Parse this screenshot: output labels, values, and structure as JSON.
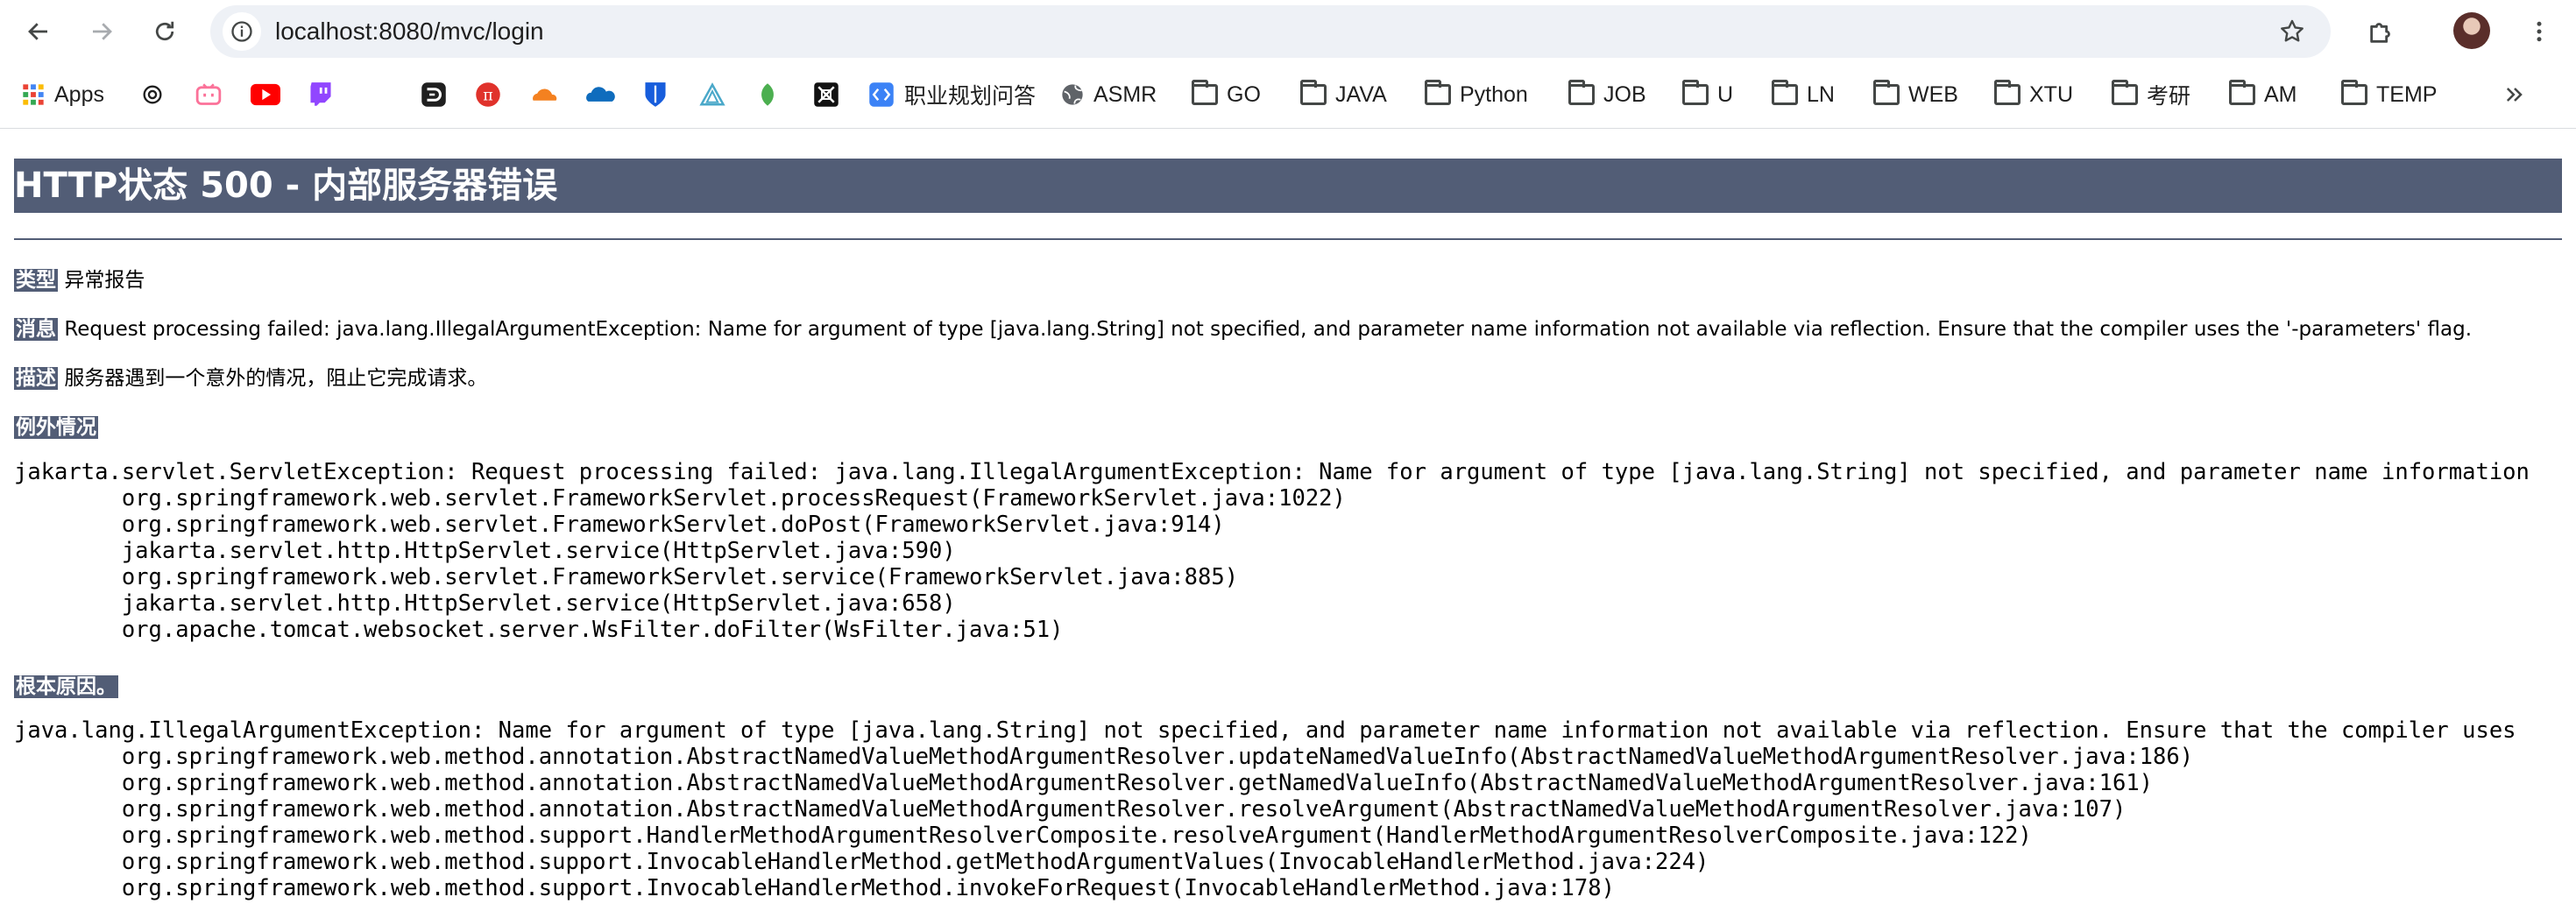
{
  "browser": {
    "url": "localhost:8080/mvc/login",
    "bookmarks": [
      {
        "label": "Apps",
        "icon": "apps-grid-icon"
      },
      {
        "label": "",
        "icon": "openai-icon"
      },
      {
        "label": "",
        "icon": "bilibili-icon"
      },
      {
        "label": "",
        "icon": "youtube-icon"
      },
      {
        "label": "",
        "icon": "twitch-icon"
      },
      {
        "label": "",
        "icon": "dash-icon"
      },
      {
        "label": "",
        "icon": "pi-icon"
      },
      {
        "label": "",
        "icon": "cloudflare-icon"
      },
      {
        "label": "",
        "icon": "onedrive-icon"
      },
      {
        "label": "",
        "icon": "bitwarden-icon"
      },
      {
        "label": "",
        "icon": "triangle-icon"
      },
      {
        "label": "",
        "icon": "leaf-icon"
      },
      {
        "label": "",
        "icon": "grid-app-icon"
      },
      {
        "label": "职业规划问答",
        "icon": "code-bracket-icon"
      },
      {
        "label": "ASMR",
        "icon": "globe-icon"
      },
      {
        "label": "GO",
        "icon": "folder-icon"
      },
      {
        "label": "JAVA",
        "icon": "folder-icon"
      },
      {
        "label": "Python",
        "icon": "folder-icon"
      },
      {
        "label": "JOB",
        "icon": "folder-icon"
      },
      {
        "label": "U",
        "icon": "folder-icon"
      },
      {
        "label": "LN",
        "icon": "folder-icon"
      },
      {
        "label": "WEB",
        "icon": "folder-icon"
      },
      {
        "label": "XTU",
        "icon": "folder-icon"
      },
      {
        "label": "考研",
        "icon": "folder-icon"
      },
      {
        "label": "AM",
        "icon": "folder-icon"
      },
      {
        "label": "TEMP",
        "icon": "folder-icon"
      }
    ]
  },
  "page": {
    "title": "HTTP状态 500 - 内部服务器错误",
    "type_label": "类型",
    "type_value": "异常报告",
    "message_label": "消息",
    "message_value": "Request processing failed: java.lang.IllegalArgumentException: Name for argument of type [java.lang.String] not specified, and parameter name information not available via reflection. Ensure that the compiler uses the '-parameters' flag.",
    "description_label": "描述",
    "description_value": "服务器遇到一个意外的情况，阻止它完成请求。",
    "exception_label": "例外情况",
    "exception_trace": "jakarta.servlet.ServletException: Request processing failed: java.lang.IllegalArgumentException: Name for argument of type [java.lang.String] not specified, and parameter name information\n\torg.springframework.web.servlet.FrameworkServlet.processRequest(FrameworkServlet.java:1022)\n\torg.springframework.web.servlet.FrameworkServlet.doPost(FrameworkServlet.java:914)\n\tjakarta.servlet.http.HttpServlet.service(HttpServlet.java:590)\n\torg.springframework.web.servlet.FrameworkServlet.service(FrameworkServlet.java:885)\n\tjakarta.servlet.http.HttpServlet.service(HttpServlet.java:658)\n\torg.apache.tomcat.websocket.server.WsFilter.doFilter(WsFilter.java:51)",
    "root_cause_label": "根本原因。",
    "root_cause_trace": "java.lang.IllegalArgumentException: Name for argument of type [java.lang.String] not specified, and parameter name information not available via reflection. Ensure that the compiler uses\n\torg.springframework.web.method.annotation.AbstractNamedValueMethodArgumentResolver.updateNamedValueInfo(AbstractNamedValueMethodArgumentResolver.java:186)\n\torg.springframework.web.method.annotation.AbstractNamedValueMethodArgumentResolver.getNamedValueInfo(AbstractNamedValueMethodArgumentResolver.java:161)\n\torg.springframework.web.method.annotation.AbstractNamedValueMethodArgumentResolver.resolveArgument(AbstractNamedValueMethodArgumentResolver.java:107)\n\torg.springframework.web.method.support.HandlerMethodArgumentResolverComposite.resolveArgument(HandlerMethodArgumentResolverComposite.java:122)\n\torg.springframework.web.method.support.InvocableHandlerMethod.getMethodArgumentValues(InvocableHandlerMethod.java:224)\n\torg.springframework.web.method.support.InvocableHandlerMethod.invokeForRequest(InvocableHandlerMethod.java:178)"
  }
}
